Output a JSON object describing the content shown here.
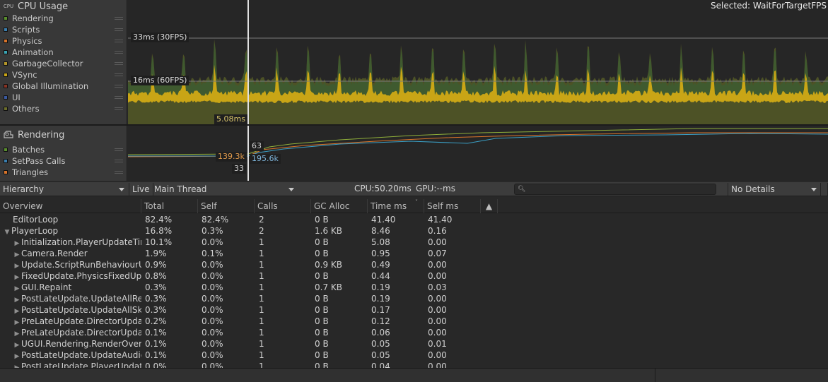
{
  "cpu_module": {
    "title": "CPU Usage",
    "icon_text": "CPU",
    "legend": [
      {
        "label": "Rendering",
        "color": "#5a8f2d"
      },
      {
        "label": "Scripts",
        "color": "#3a7fb0"
      },
      {
        "label": "Physics",
        "color": "#d9742a"
      },
      {
        "label": "Animation",
        "color": "#3aa6b5"
      },
      {
        "label": "GarbageCollector",
        "color": "#b4962a"
      },
      {
        "label": "VSync",
        "color": "#c9a516"
      },
      {
        "label": "Global Illumination",
        "color": "#8a3424"
      },
      {
        "label": "UI",
        "color": "#3b5aa0"
      },
      {
        "label": "Others",
        "color": "#6c6e2a"
      }
    ],
    "ref_33": "33ms (30FPS)",
    "ref_16": "16ms (60FPS)",
    "marker_value": "5.08ms",
    "selected": "Selected: WaitForTargetFPS"
  },
  "rendering_module": {
    "title": "Rendering",
    "legend": [
      {
        "label": "Batches",
        "color": "#5a8f2d"
      },
      {
        "label": "SetPass Calls",
        "color": "#3a7fb0"
      },
      {
        "label": "Triangles",
        "color": "#d9742a"
      }
    ],
    "marker_batches": "63",
    "marker_triangles": "139.3k",
    "marker_setpass": "33",
    "marker_vertices": "195.6k"
  },
  "toolbar": {
    "view": "Hierarchy",
    "live": "Live",
    "thread": "Main Thread",
    "cpu": "CPU:50.20ms",
    "gpu": "GPU:--ms",
    "search_placeholder": "",
    "details": "No Details"
  },
  "table": {
    "headers": [
      "Overview",
      "Total",
      "Self",
      "Calls",
      "GC Alloc",
      "Time ms",
      "Self ms",
      "▲"
    ],
    "rows": [
      {
        "expander": "",
        "indent": 0,
        "name": "EditorLoop",
        "total": "82.4%",
        "self": "82.4%",
        "calls": "2",
        "gc": "0 B",
        "time": "41.40",
        "selfms": "41.40"
      },
      {
        "expander": "▼",
        "indent": 0,
        "name": "PlayerLoop",
        "total": "16.8%",
        "self": "0.3%",
        "calls": "2",
        "gc": "1.6 KB",
        "time": "8.46",
        "selfms": "0.16"
      },
      {
        "expander": "▶",
        "indent": 1,
        "name": "Initialization.PlayerUpdateTim",
        "total": "10.1%",
        "self": "0.0%",
        "calls": "1",
        "gc": "0 B",
        "time": "5.08",
        "selfms": "0.00"
      },
      {
        "expander": "▶",
        "indent": 1,
        "name": "Camera.Render",
        "total": "1.9%",
        "self": "0.1%",
        "calls": "1",
        "gc": "0 B",
        "time": "0.95",
        "selfms": "0.07"
      },
      {
        "expander": "▶",
        "indent": 1,
        "name": "Update.ScriptRunBehaviourU",
        "total": "0.9%",
        "self": "0.0%",
        "calls": "1",
        "gc": "0.9 KB",
        "time": "0.49",
        "selfms": "0.00"
      },
      {
        "expander": "▶",
        "indent": 1,
        "name": "FixedUpdate.PhysicsFixedUpd",
        "total": "0.8%",
        "self": "0.0%",
        "calls": "1",
        "gc": "0 B",
        "time": "0.44",
        "selfms": "0.00"
      },
      {
        "expander": "▶",
        "indent": 1,
        "name": "GUI.Repaint",
        "total": "0.3%",
        "self": "0.0%",
        "calls": "1",
        "gc": "0.7 KB",
        "time": "0.19",
        "selfms": "0.03"
      },
      {
        "expander": "▶",
        "indent": 1,
        "name": "PostLateUpdate.UpdateAllRen",
        "total": "0.3%",
        "self": "0.0%",
        "calls": "1",
        "gc": "0 B",
        "time": "0.19",
        "selfms": "0.00"
      },
      {
        "expander": "▶",
        "indent": 1,
        "name": "PostLateUpdate.UpdateAllSki",
        "total": "0.3%",
        "self": "0.0%",
        "calls": "1",
        "gc": "0 B",
        "time": "0.17",
        "selfms": "0.00"
      },
      {
        "expander": "▶",
        "indent": 1,
        "name": "PreLateUpdate.DirectorUpdat",
        "total": "0.2%",
        "self": "0.0%",
        "calls": "1",
        "gc": "0 B",
        "time": "0.12",
        "selfms": "0.00"
      },
      {
        "expander": "▶",
        "indent": 1,
        "name": "PreLateUpdate.DirectorUpdat",
        "total": "0.1%",
        "self": "0.0%",
        "calls": "1",
        "gc": "0 B",
        "time": "0.06",
        "selfms": "0.00"
      },
      {
        "expander": "▶",
        "indent": 1,
        "name": "UGUI.Rendering.RenderOverla",
        "total": "0.1%",
        "self": "0.0%",
        "calls": "1",
        "gc": "0 B",
        "time": "0.05",
        "selfms": "0.01"
      },
      {
        "expander": "▶",
        "indent": 1,
        "name": "PostLateUpdate.UpdateAudio",
        "total": "0.1%",
        "self": "0.0%",
        "calls": "1",
        "gc": "0 B",
        "time": "0.05",
        "selfms": "0.00"
      },
      {
        "expander": "▶",
        "indent": 1,
        "name": "PostLateUpdate.PlayerUpdate",
        "total": "0.0%",
        "self": "0.0%",
        "calls": "1",
        "gc": "0 B",
        "time": "0.04",
        "selfms": "0.00"
      }
    ]
  }
}
